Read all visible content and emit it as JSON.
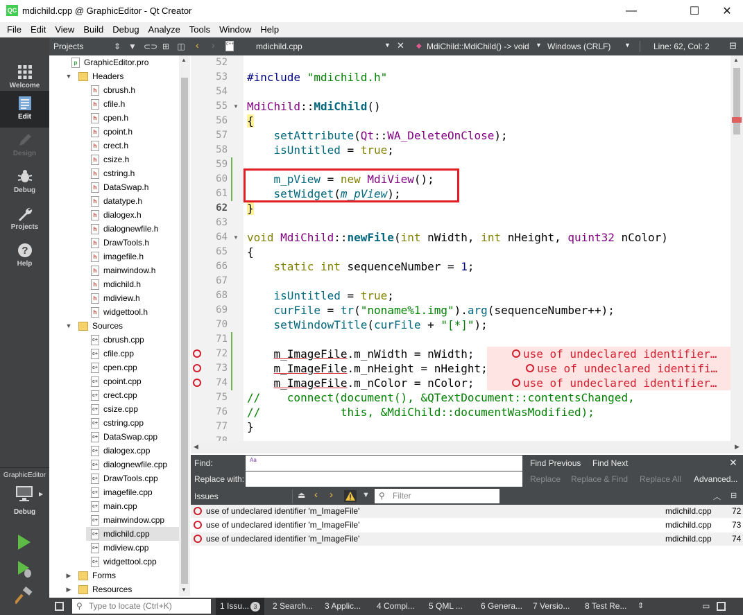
{
  "window": {
    "title": "mdichild.cpp @ GraphicEditor - Qt Creator",
    "app_icon": "QC",
    "minimize": "—",
    "maximize": "☐",
    "close": "✕"
  },
  "menu": [
    "File",
    "Edit",
    "View",
    "Build",
    "Debug",
    "Analyze",
    "Tools",
    "Window",
    "Help"
  ],
  "modes": [
    {
      "label": "Welcome",
      "icon": "grid-icon"
    },
    {
      "label": "Edit",
      "icon": "document-icon"
    },
    {
      "label": "Design",
      "icon": "pencil-icon"
    },
    {
      "label": "Debug",
      "icon": "bug-icon"
    },
    {
      "label": "Projects",
      "icon": "wrench-icon"
    },
    {
      "label": "Help",
      "icon": "question-icon"
    }
  ],
  "kit": {
    "project": "GraphicEditor",
    "build": "Debug"
  },
  "projects_pane": {
    "title": "Projects",
    "root": "GraphicEditor.pro",
    "headers_label": "Headers",
    "headers": [
      "cbrush.h",
      "cfile.h",
      "cpen.h",
      "cpoint.h",
      "crect.h",
      "csize.h",
      "cstring.h",
      "DataSwap.h",
      "datatype.h",
      "dialogex.h",
      "dialognewfile.h",
      "DrawTools.h",
      "imagefile.h",
      "mainwindow.h",
      "mdichild.h",
      "mdiview.h",
      "widgettool.h"
    ],
    "sources_label": "Sources",
    "sources": [
      "cbrush.cpp",
      "cfile.cpp",
      "cpen.cpp",
      "cpoint.cpp",
      "crect.cpp",
      "csize.cpp",
      "cstring.cpp",
      "DataSwap.cpp",
      "dialogex.cpp",
      "dialognewfile.cpp",
      "DrawTools.cpp",
      "imagefile.cpp",
      "main.cpp",
      "mainwindow.cpp",
      "mdichild.cpp",
      "mdiview.cpp",
      "widgettool.cpp"
    ],
    "forms_label": "Forms",
    "resources_label": "Resources"
  },
  "editor_bar": {
    "file": "mdichild.cpp",
    "symbol": "MdiChild::MdiChild() -> void",
    "encoding": "Windows (CRLF)",
    "position": "Line: 62, Col: 2"
  },
  "code": {
    "line_numbers": [
      "52",
      "53",
      "54",
      "55",
      "56",
      "57",
      "58",
      "59",
      "60",
      "61",
      "62",
      "63",
      "64",
      "65",
      "66",
      "67",
      "68",
      "69",
      "70",
      "71",
      "72",
      "73",
      "74",
      "75",
      "76",
      "77",
      "78"
    ],
    "diagnostics": [
      "use of undeclared identifier…",
      "use of undeclared identifi…",
      "use of undeclared identifier…"
    ]
  },
  "find": {
    "find_label": "Find:",
    "replace_label": "Replace with:",
    "find_previous": "Find Previous",
    "find_next": "Find Next",
    "replace": "Replace",
    "replace_find": "Replace & Find",
    "replace_all": "Replace All",
    "advanced": "Advanced...",
    "case_icon": "Aa"
  },
  "issues": {
    "title": "Issues",
    "filter_placeholder": "Filter",
    "rows": [
      {
        "message": "use of undeclared identifier 'm_ImageFile'",
        "file": "mdichild.cpp",
        "line": "72"
      },
      {
        "message": "use of undeclared identifier 'm_ImageFile'",
        "file": "mdichild.cpp",
        "line": "73"
      },
      {
        "message": "use of undeclared identifier 'm_ImageFile'",
        "file": "mdichild.cpp",
        "line": "74"
      }
    ]
  },
  "statusbar": {
    "locator_placeholder": "Type to locate (Ctrl+K)",
    "tabs": [
      "1 Issu...",
      "2 Search...",
      "3 Applic...",
      "4 Compi...",
      "5 QML ...",
      "6 Genera...",
      "7 Versio...",
      "8 Test Re..."
    ],
    "issue_count": "3"
  }
}
